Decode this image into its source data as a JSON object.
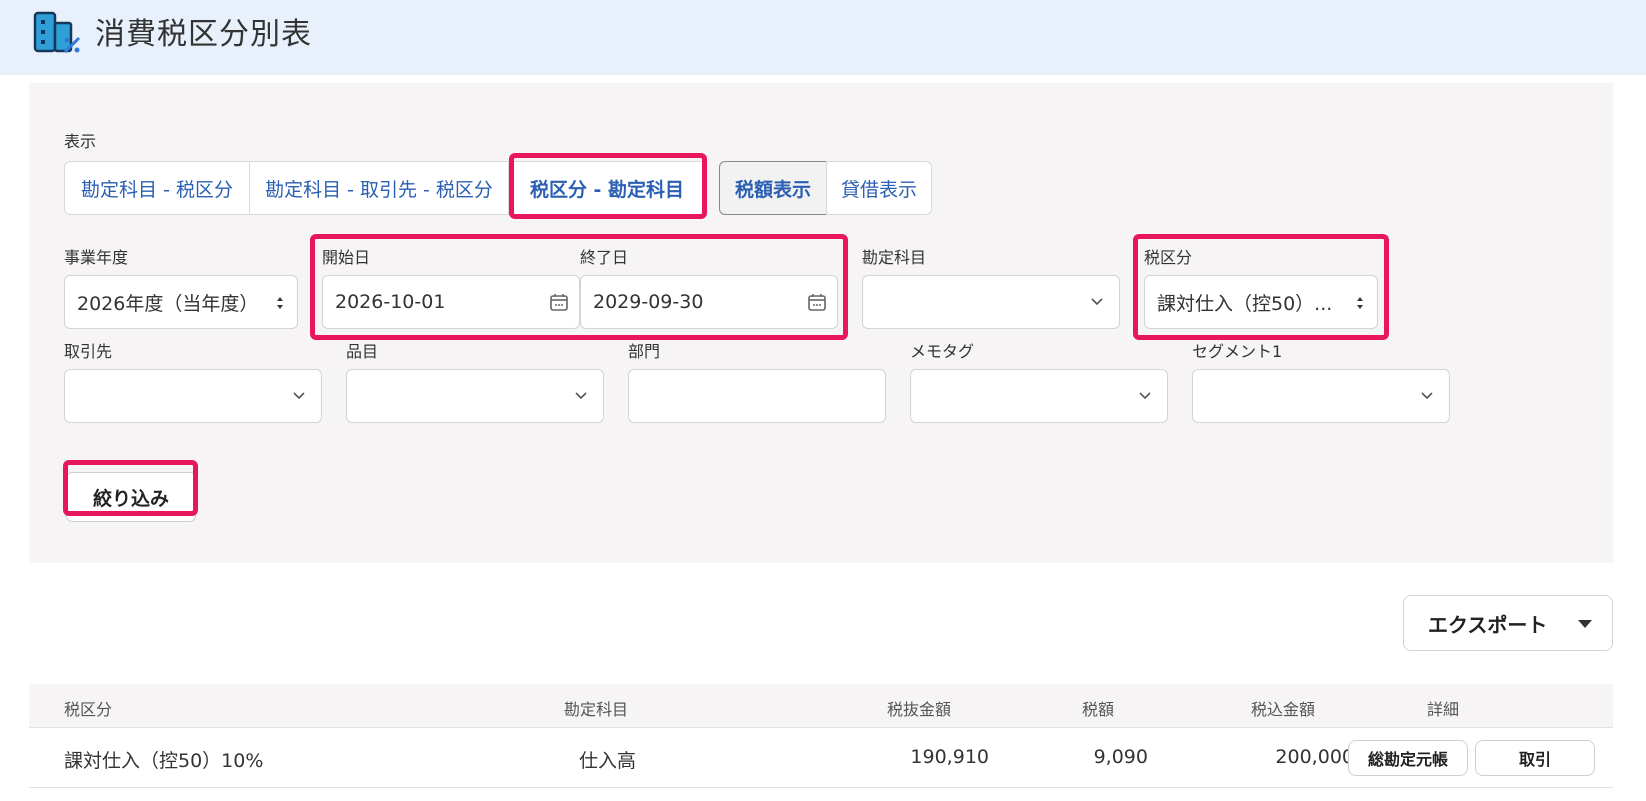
{
  "page": {
    "title": "消費税区分別表",
    "icon": "building-chart-icon"
  },
  "display": {
    "label": "表示",
    "view_options": [
      "勘定科目 - 税区分",
      "勘定科目 - 取引先 - 税区分",
      "税区分 - 勘定科目"
    ],
    "selected_view": "税区分 - 勘定科目",
    "amount_options": [
      "税額表示",
      "貸借表示"
    ],
    "selected_amount": "税額表示"
  },
  "filters": {
    "fiscal_year": {
      "label": "事業年度",
      "value": "2026年度（当年度）"
    },
    "start_date": {
      "label": "開始日",
      "value": "2026-10-01"
    },
    "end_date": {
      "label": "終了日",
      "value": "2029-09-30"
    },
    "account": {
      "label": "勘定科目",
      "value": ""
    },
    "tax_category": {
      "label": "税区分",
      "value": "課対仕入（控50）..."
    },
    "partner": {
      "label": "取引先",
      "value": ""
    },
    "item": {
      "label": "品目",
      "value": ""
    },
    "department": {
      "label": "部門",
      "value": ""
    },
    "memo_tag": {
      "label": "メモタグ",
      "value": ""
    },
    "segment1": {
      "label": "セグメント1",
      "value": ""
    },
    "filter_button": "絞り込み"
  },
  "export_button": "エクスポート",
  "table": {
    "headers": [
      "税区分",
      "勘定科目",
      "税抜金額",
      "税額",
      "税込金額",
      "詳細"
    ],
    "rows": [
      {
        "tax_category": "課対仕入（控50）10%",
        "account": "仕入高",
        "excl": "190,910",
        "tax": "9,090",
        "incl": "200,000",
        "buttons": [
          "総勘定元帳",
          "取引"
        ]
      }
    ]
  },
  "colors": {
    "highlight": "#e8175d",
    "link": "#2b5fb3",
    "header_bg": "#e8f1fb"
  }
}
